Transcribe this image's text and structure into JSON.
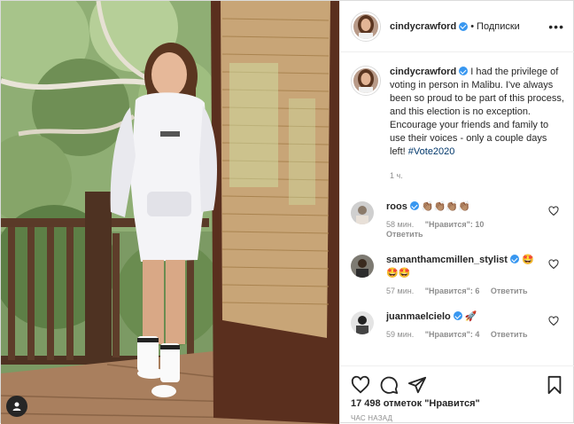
{
  "colors": {
    "verified": "#3897f0",
    "hashtag": "#00376b",
    "muted": "#8e8e8e",
    "text": "#262626"
  },
  "header": {
    "username": "cindycrawford",
    "separator": "•",
    "follow_label": "Подписки",
    "more_label": "•••"
  },
  "caption": {
    "username": "cindycrawford",
    "text": "I had the privilege of voting in person in Malibu. I've always been so proud to be part of this process, and this election is no exception. Encourage your friends and family to use their voices - only a couple days left!",
    "hashtag": "#Vote2020",
    "time": "1 ч."
  },
  "comments": [
    {
      "username": "roos",
      "emoji": "👏🏽👏🏽👏🏽👏🏽",
      "verified": true,
      "time": "58 мин.",
      "likes": "\"Нравится\": 10",
      "reply": "Ответить"
    },
    {
      "username": "samanthamcmillen_stylist",
      "emoji": "🤩🤩🤩",
      "verified": true,
      "time": "57 мин.",
      "likes": "\"Нравится\": 6",
      "reply": "Ответить"
    },
    {
      "username": "juanmaelcielo",
      "emoji": "🚀",
      "verified": true,
      "time": "59 мин.",
      "likes": "\"Нравится\": 4",
      "reply": "Ответить"
    }
  ],
  "actions": {
    "icons": [
      "heart-icon",
      "comment-icon",
      "share-icon",
      "bookmark-icon"
    ],
    "likes_count": "17 498 отметок",
    "likes_word": "\"Нравится\"",
    "posted_ago": "ЧАС НАЗАД"
  },
  "photo": {
    "tag_icon": "person-tag-icon"
  }
}
